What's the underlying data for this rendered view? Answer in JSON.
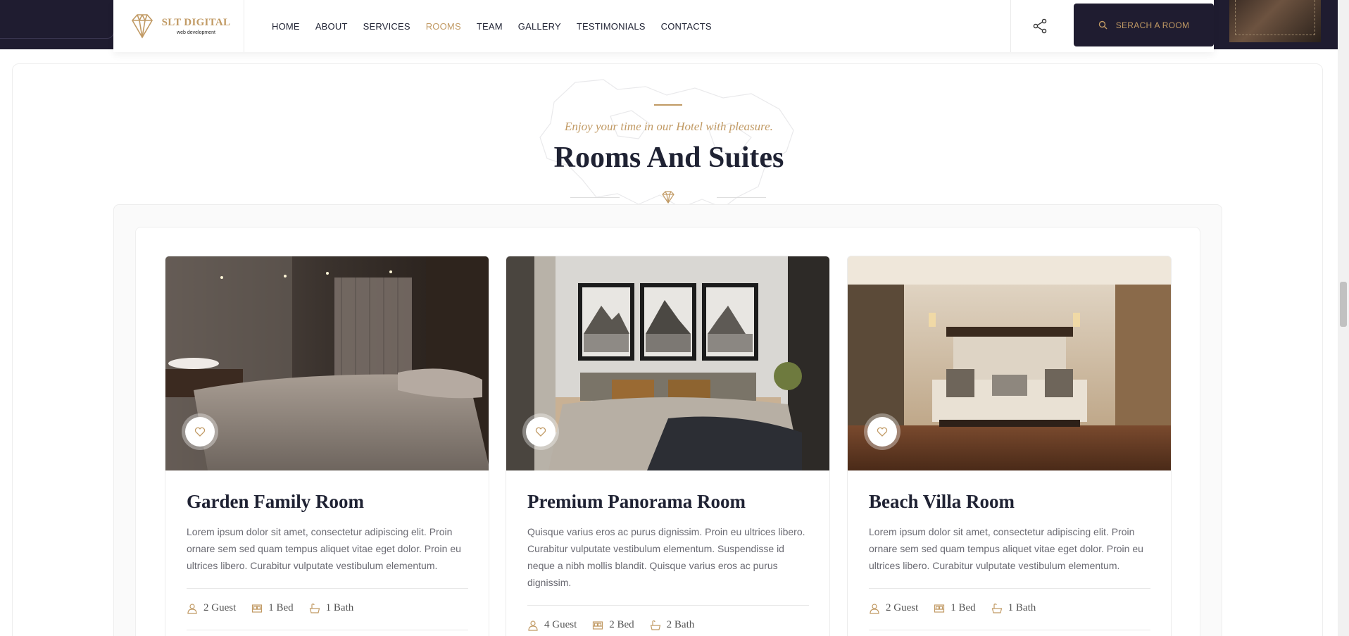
{
  "brand": {
    "name": "SLT DIGITAL",
    "tagline": "web development"
  },
  "nav": [
    {
      "label": "HOME",
      "active": false
    },
    {
      "label": "ABOUT",
      "active": false
    },
    {
      "label": "SERVICES",
      "active": false
    },
    {
      "label": "ROOMS",
      "active": true
    },
    {
      "label": "TEAM",
      "active": false
    },
    {
      "label": "GALLERY",
      "active": false
    },
    {
      "label": "TESTIMONIALS",
      "active": false
    },
    {
      "label": "CONTACTS",
      "active": false
    }
  ],
  "header": {
    "search_label": "SERACH A ROOM"
  },
  "section": {
    "subtitle": "Enjoy your time in our Hotel with pleasure.",
    "title": "Rooms And Suites"
  },
  "rooms": [
    {
      "title": "Garden Family Room",
      "description": "Lorem ipsum dolor sit amet, consectetur adipiscing elit. Proin ornare sem sed quam tempus aliquet vitae eget dolor. Proin eu ultrices libero. Curabitur vulputate vestibulum elementum.",
      "guests": "2 Guest",
      "beds": "1 Bed",
      "baths": "1 Bath"
    },
    {
      "title": "Premium Panorama Room",
      "description": "Quisque varius eros ac purus dignissim. Proin eu ultrices libero. Curabitur vulputate vestibulum elementum. Suspendisse id neque a nibh mollis blandit. Quisque varius eros ac purus dignissim.",
      "guests": "4 Guest",
      "beds": "2 Bed",
      "baths": "2 Bath"
    },
    {
      "title": "Beach Villa Room",
      "description": "Lorem ipsum dolor sit amet, consectetur adipiscing elit. Proin ornare sem sed quam tempus aliquet vitae eget dolor. Proin eu ultrices libero. Curabitur vulputate vestibulum elementum.",
      "guests": "2 Guest",
      "beds": "1 Bed",
      "baths": "1 Bath"
    }
  ],
  "colors": {
    "accent": "#c19a64",
    "dark": "#1f1c30",
    "text": "#1f2233",
    "muted": "#6a6a72"
  }
}
